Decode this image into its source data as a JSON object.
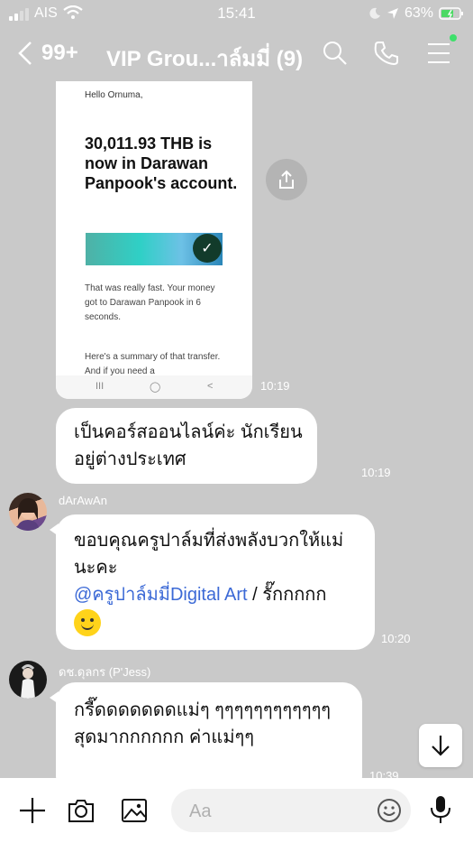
{
  "status": {
    "carrier": "AIS",
    "time": "15:41",
    "battery": "63%"
  },
  "header": {
    "unread_count": "99+",
    "title": "VIP Grou...าล์มมี่ (9)"
  },
  "messages": {
    "image": {
      "hello": "Hello Ornuma,",
      "amount_text": "30,011.93 THB is now in Darawan Panpook's account.",
      "fast_text": "That was really fast. Your money got to Darawan Panpook in 6 seconds.",
      "summary_text": "Here's a summary of that transfer. And if you need a",
      "nav": [
        "III",
        "◯",
        "<"
      ],
      "time": "10:19"
    },
    "msg1": {
      "text": "เป็นคอร์สออนไลน์ค่ะ นักเรียนอยู่ต่างประเทศ",
      "time": "10:19"
    },
    "msg2": {
      "sender": "dArAwAn",
      "text_start": "ขอบคุณครูปาล์มที่ส่งพลังบวกให้แม่นะคะ",
      "mention": "@ครูปาล์มมี่Digital Art",
      "text_end": " / รั๊กกกกก",
      "time": "10:20"
    },
    "msg3": {
      "sender": "ดช.ดุลกร (P'Jess)",
      "text": "กรี๊ดดดดดดดแม่ๆ ๆๆๆๆๆๆๆๆๆๆๆๆ สุดมากกกกกก ค่าแม่ๆๆ",
      "time": "10:39"
    }
  },
  "composer": {
    "placeholder": "Aa"
  },
  "colors": {
    "background": "#c9c9c9",
    "bubble": "#ffffff",
    "mention": "#3b69d6",
    "online_dot": "#3ee06b"
  }
}
